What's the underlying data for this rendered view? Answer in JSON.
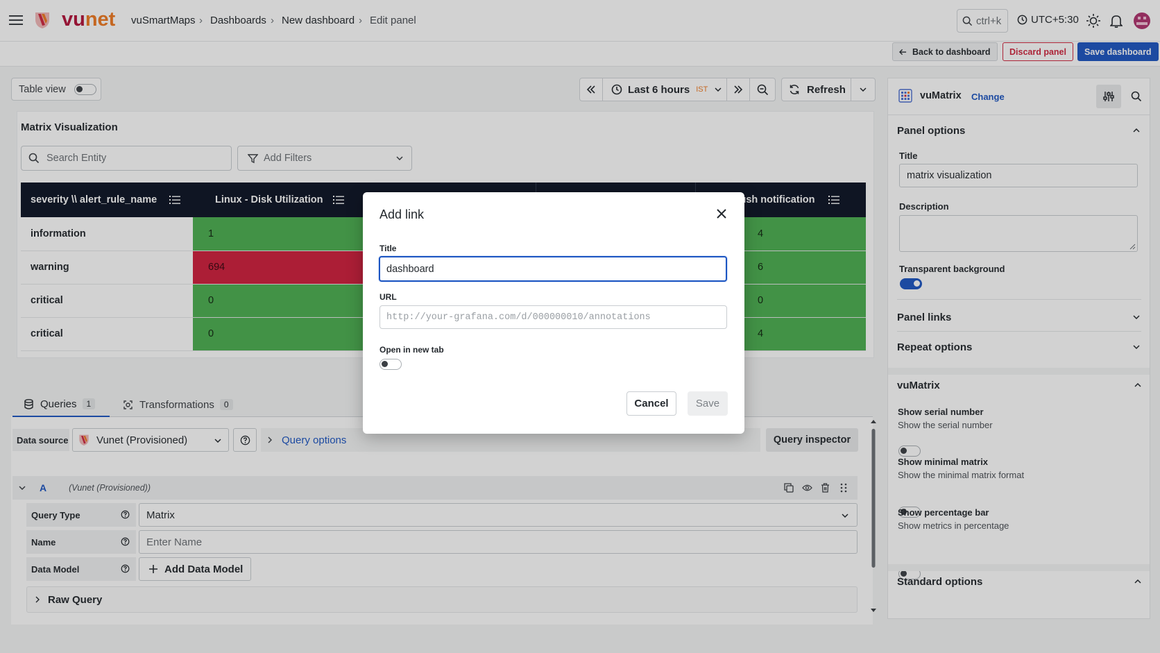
{
  "topbar": {
    "logo": {
      "part1": "vu",
      "part2": "net"
    },
    "breadcrumbs": [
      "vuSmartMaps",
      "Dashboards",
      "New dashboard",
      "Edit panel"
    ],
    "search_shortcut": "ctrl+k",
    "timezone": "UTC+5:30"
  },
  "actions": {
    "back": "Back to dashboard",
    "discard": "Discard panel",
    "save": "Save dashboard"
  },
  "toolbar": {
    "table_view_label": "Table view",
    "time_range": "Last 6 hours",
    "tz_badge": "IST",
    "refresh": "Refresh"
  },
  "panel": {
    "title": "Matrix Visualization",
    "search_placeholder": "Search Entity",
    "filters_label": "Add Filters"
  },
  "matrix": {
    "columns": [
      "severity \\\\ alert_rule_name",
      "Linux - Disk Utilization",
      "",
      "",
      "ush notification"
    ],
    "rows": [
      {
        "label": "information",
        "cells": [
          "1",
          "",
          "",
          "4"
        ]
      },
      {
        "label": "warning",
        "cells": [
          "694",
          "",
          "",
          "6"
        ]
      },
      {
        "label": "critical",
        "cells": [
          "0",
          "",
          "",
          "0"
        ]
      },
      {
        "label": "critical",
        "cells": [
          "0",
          "",
          "",
          "4"
        ]
      }
    ],
    "colors": {
      "green": "#4caf50",
      "red": "#d01f3c",
      "header": "#0c1325"
    }
  },
  "query_tabs": [
    {
      "label": "Queries",
      "count": "1"
    },
    {
      "label": "Transformations",
      "count": "0"
    }
  ],
  "query": {
    "data_source_label": "Data source",
    "data_source_value": "Vunet (Provisioned)",
    "options_label": "Query options",
    "inspector_label": "Query inspector",
    "ref_id": "A",
    "ref_source": "(Vunet (Provisioned))",
    "type_label": "Query Type",
    "type_value": "Matrix",
    "name_label": "Name",
    "name_placeholder": "Enter Name",
    "data_model_label": "Data Model",
    "add_data_model": "Add Data Model",
    "raw_query": "Raw Query"
  },
  "right_panel": {
    "viz_name": "vuMatrix",
    "change_label": "Change",
    "panel_options": "Panel options",
    "title_label": "Title",
    "title_value": "matrix visualization",
    "description_label": "Description",
    "transparent_label": "Transparent background",
    "panel_links": "Panel links",
    "repeat_options": "Repeat options",
    "vumatrix_section": "vuMatrix",
    "options": [
      {
        "title": "Show serial number",
        "desc": "Show the serial number"
      },
      {
        "title": "Show minimal matrix",
        "desc": "Show the minimal matrix format"
      },
      {
        "title": "Show percentage bar",
        "desc": "Show metrics in percentage"
      }
    ],
    "standard_options": "Standard options"
  },
  "modal": {
    "title": "Add link",
    "title_label": "Title",
    "title_value": "dashboard",
    "url_label": "URL",
    "url_placeholder": "http://your-grafana.com/d/000000010/annotations",
    "new_tab_label": "Open in new tab",
    "cancel": "Cancel",
    "save": "Save"
  }
}
